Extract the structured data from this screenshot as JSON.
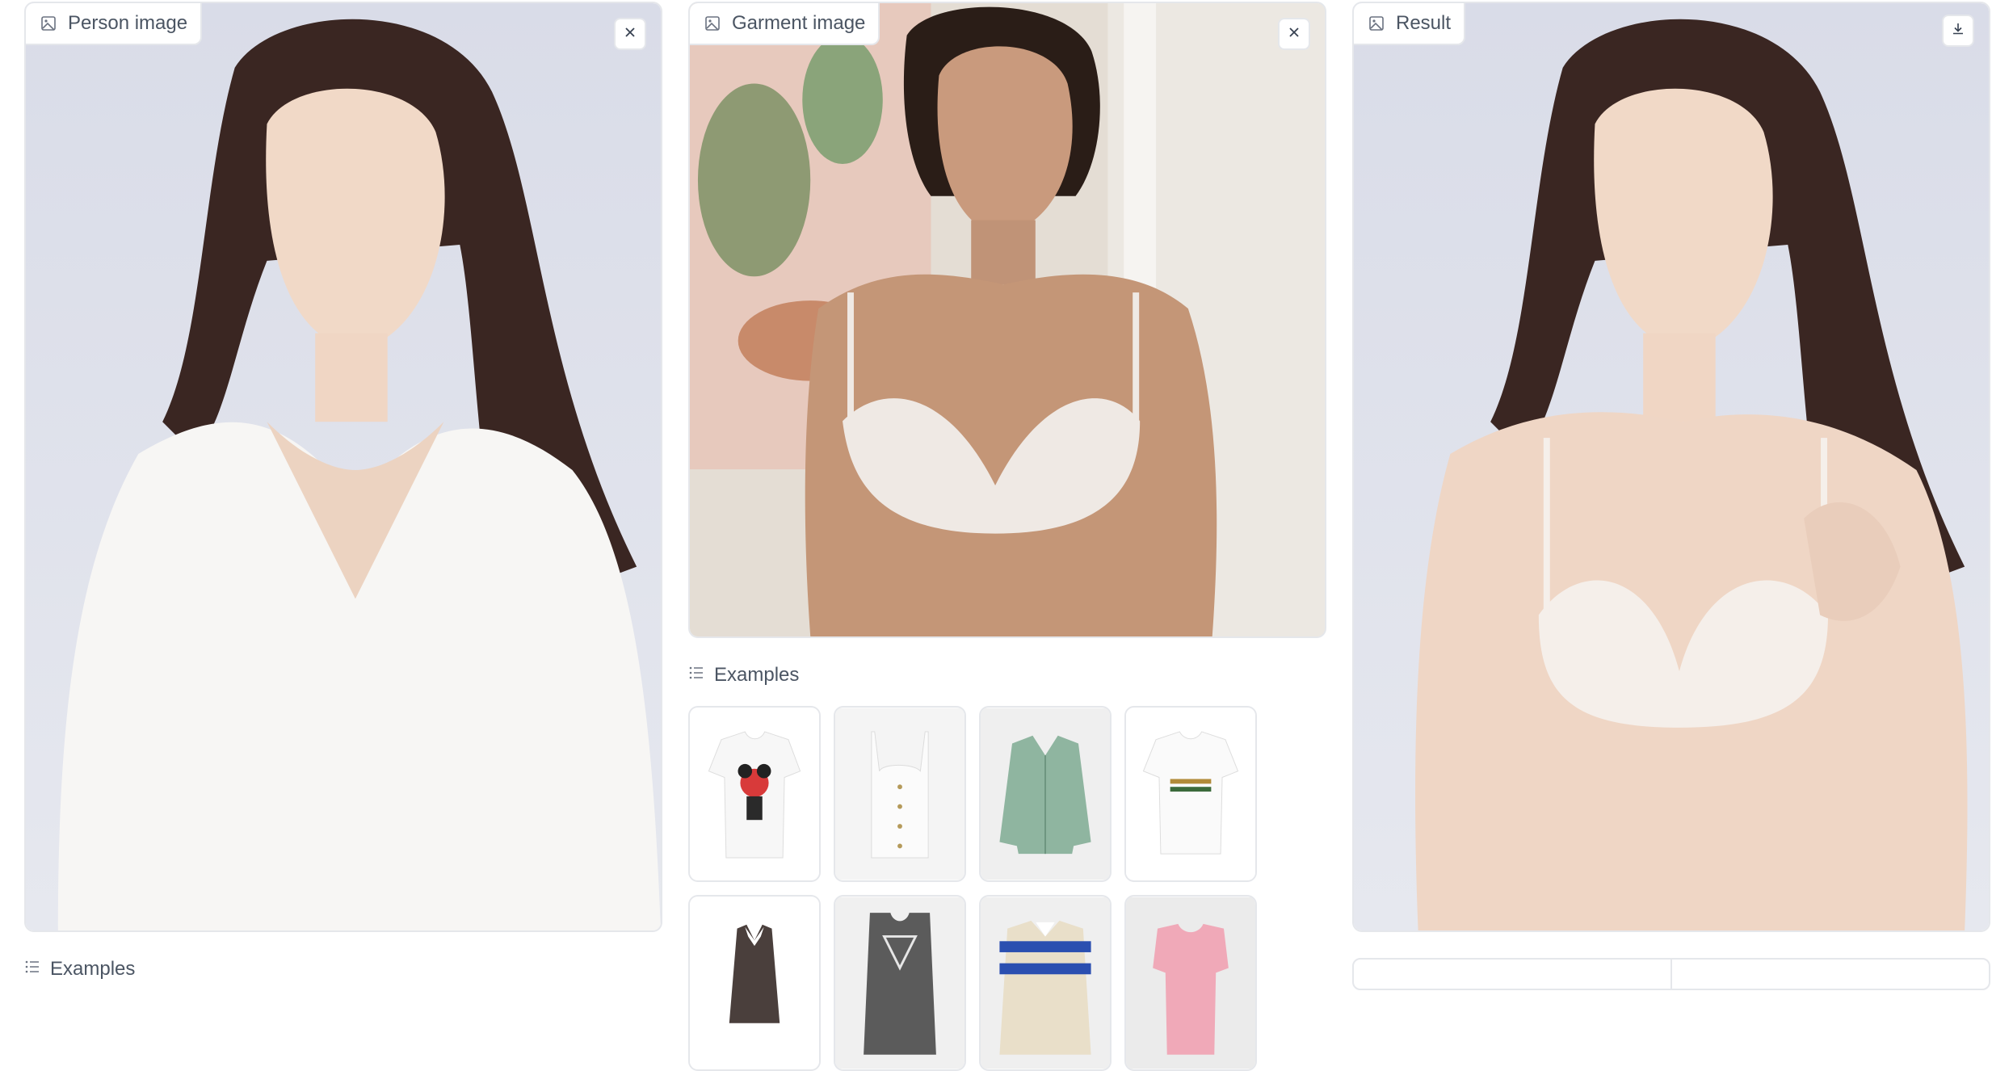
{
  "person_panel": {
    "label": "Person image",
    "image_alt": "Person image",
    "icon": "image-icon",
    "action_icon": "close-icon"
  },
  "garment_panel": {
    "label": "Garment image",
    "image_alt": "Garment image",
    "icon": "image-icon",
    "action_icon": "close-icon"
  },
  "result_panel": {
    "label": "Result",
    "image_alt": "Result",
    "icon": "image-icon",
    "action_icon": "download-icon"
  },
  "garment_examples": {
    "label": "Examples",
    "icon": "list-icon"
  },
  "person_examples": {
    "label": "Examples",
    "icon": "list-icon"
  },
  "colors": {
    "border": "#e5e7eb",
    "label_text": "#4b5563",
    "panel_bg": "#dde0ea"
  }
}
